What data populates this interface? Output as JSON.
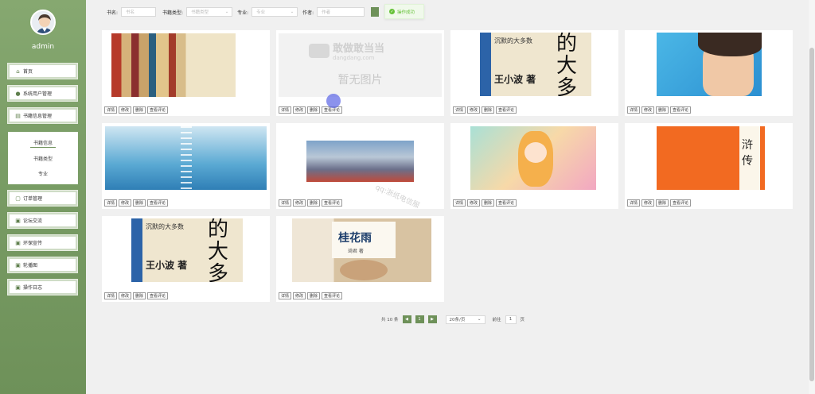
{
  "sidebar": {
    "username": "admin",
    "menu": [
      {
        "label": "首页",
        "icon": "home-icon"
      },
      {
        "label": "系统用户管理",
        "icon": "user-icon"
      },
      {
        "label": "书籍信息管理",
        "icon": "book-icon"
      },
      {
        "label": "订单管理",
        "icon": "order-icon"
      },
      {
        "label": "论坛交流",
        "icon": "forum-icon"
      },
      {
        "label": "环保宣传",
        "icon": "eco-icon"
      },
      {
        "label": "轮播图",
        "icon": "image-icon"
      },
      {
        "label": "操作日志",
        "icon": "log-icon"
      }
    ],
    "submenu": [
      "书籍信息",
      "书籍类型",
      "专业"
    ]
  },
  "filters": {
    "name_label": "书名:",
    "name_placeholder": "书名",
    "type_label": "书籍类型:",
    "type_placeholder": "书籍类型",
    "major_label": "专业:",
    "major_placeholder": "专业",
    "author_label": "作者:",
    "author_placeholder": "作者"
  },
  "toast": {
    "text": "操作成功"
  },
  "card_actions": [
    "详情",
    "修改",
    "删除",
    "查看评论"
  ],
  "books": [
    {
      "cover": "tomb-notes"
    },
    {
      "cover": "no-image",
      "brand_cn": "敢做敢当当",
      "brand_en": "dangdang.com",
      "no_image_text": "暂无图片"
    },
    {
      "cover": "silent-majority",
      "title": "沉默的大多数",
      "author": "王小波 著",
      "big": "的大多"
    },
    {
      "cover": "portrait"
    },
    {
      "cover": "ladder"
    },
    {
      "cover": "landscape"
    },
    {
      "cover": "anime"
    },
    {
      "cover": "orange",
      "big": "浒传"
    },
    {
      "cover": "silent-majority",
      "title": "沉默的大多数",
      "author": "王小波 著",
      "big": "的大多"
    },
    {
      "cover": "osmanthus",
      "title": "桂花雨",
      "author": "琦君 著"
    }
  ],
  "pagination": {
    "total": "共 10 条",
    "prev": "◀",
    "page": "1",
    "next": "▶",
    "page_size": "20条/页",
    "goto_label": "前往",
    "goto_value": "1",
    "page_unit": "页"
  },
  "watermark": "qq:浙纸电信服"
}
